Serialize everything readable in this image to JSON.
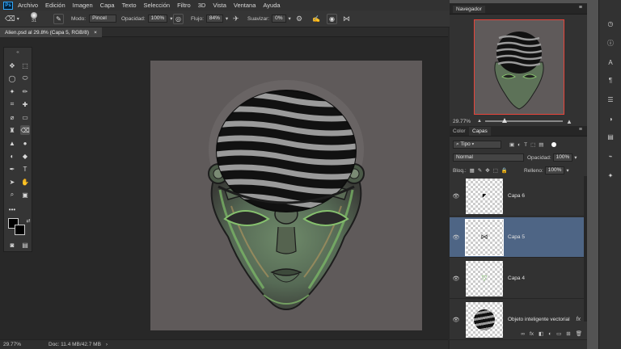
{
  "app": {
    "logo_text": "Ps"
  },
  "menu": [
    "Archivo",
    "Edición",
    "Imagen",
    "Capa",
    "Texto",
    "Selección",
    "Filtro",
    "3D",
    "Vista",
    "Ventana",
    "Ayuda"
  ],
  "window_controls": [
    "–",
    "❐",
    "✕"
  ],
  "options_bar": {
    "brush_size": "31",
    "mode_label": "Modo:",
    "mode_value": "Pincel",
    "opacity_label": "Opacidad:",
    "opacity_value": "100%",
    "flow_label": "Flujo:",
    "flow_value": "84%",
    "smoothing_label": "Suavizar:",
    "smoothing_value": "0%"
  },
  "document": {
    "tab_title": "Alien.psd al 29.8% (Capa 5, RGB/8)",
    "close": "×"
  },
  "status_bar": {
    "zoom": "29.77%",
    "doc_info": "Doc: 11.4 MB/42.7 MB",
    "arrow": "›"
  },
  "navigator": {
    "title": "Navegador",
    "zoom": "29.77%",
    "zoom_slider_fraction": 0.25
  },
  "layers_panel": {
    "tabs": [
      "Color",
      "Capas"
    ],
    "kind_filter": "Tipo",
    "blend_mode": "Normal",
    "opacity_label": "Opacidad:",
    "opacity_value": "100%",
    "lock_label": "Bloq.:",
    "fill_label": "Relleno:",
    "fill_value": "100%",
    "layers": [
      {
        "name": "Capa 6",
        "selected": false
      },
      {
        "name": "Capa 5",
        "selected": true
      },
      {
        "name": "Capa 4",
        "selected": false
      },
      {
        "name": "Objeto inteligente vectorial",
        "selected": false,
        "fx": "fx"
      }
    ],
    "footer_icons": [
      "∞",
      "fx",
      "◧",
      "◐",
      "▭",
      "⊞",
      "🗑"
    ]
  },
  "colors": {
    "selected_layer": "#4e6585",
    "navigator_frame": "#e8443a",
    "canvas": "#5f5a5a",
    "alien_green": "#4e7a4e"
  }
}
